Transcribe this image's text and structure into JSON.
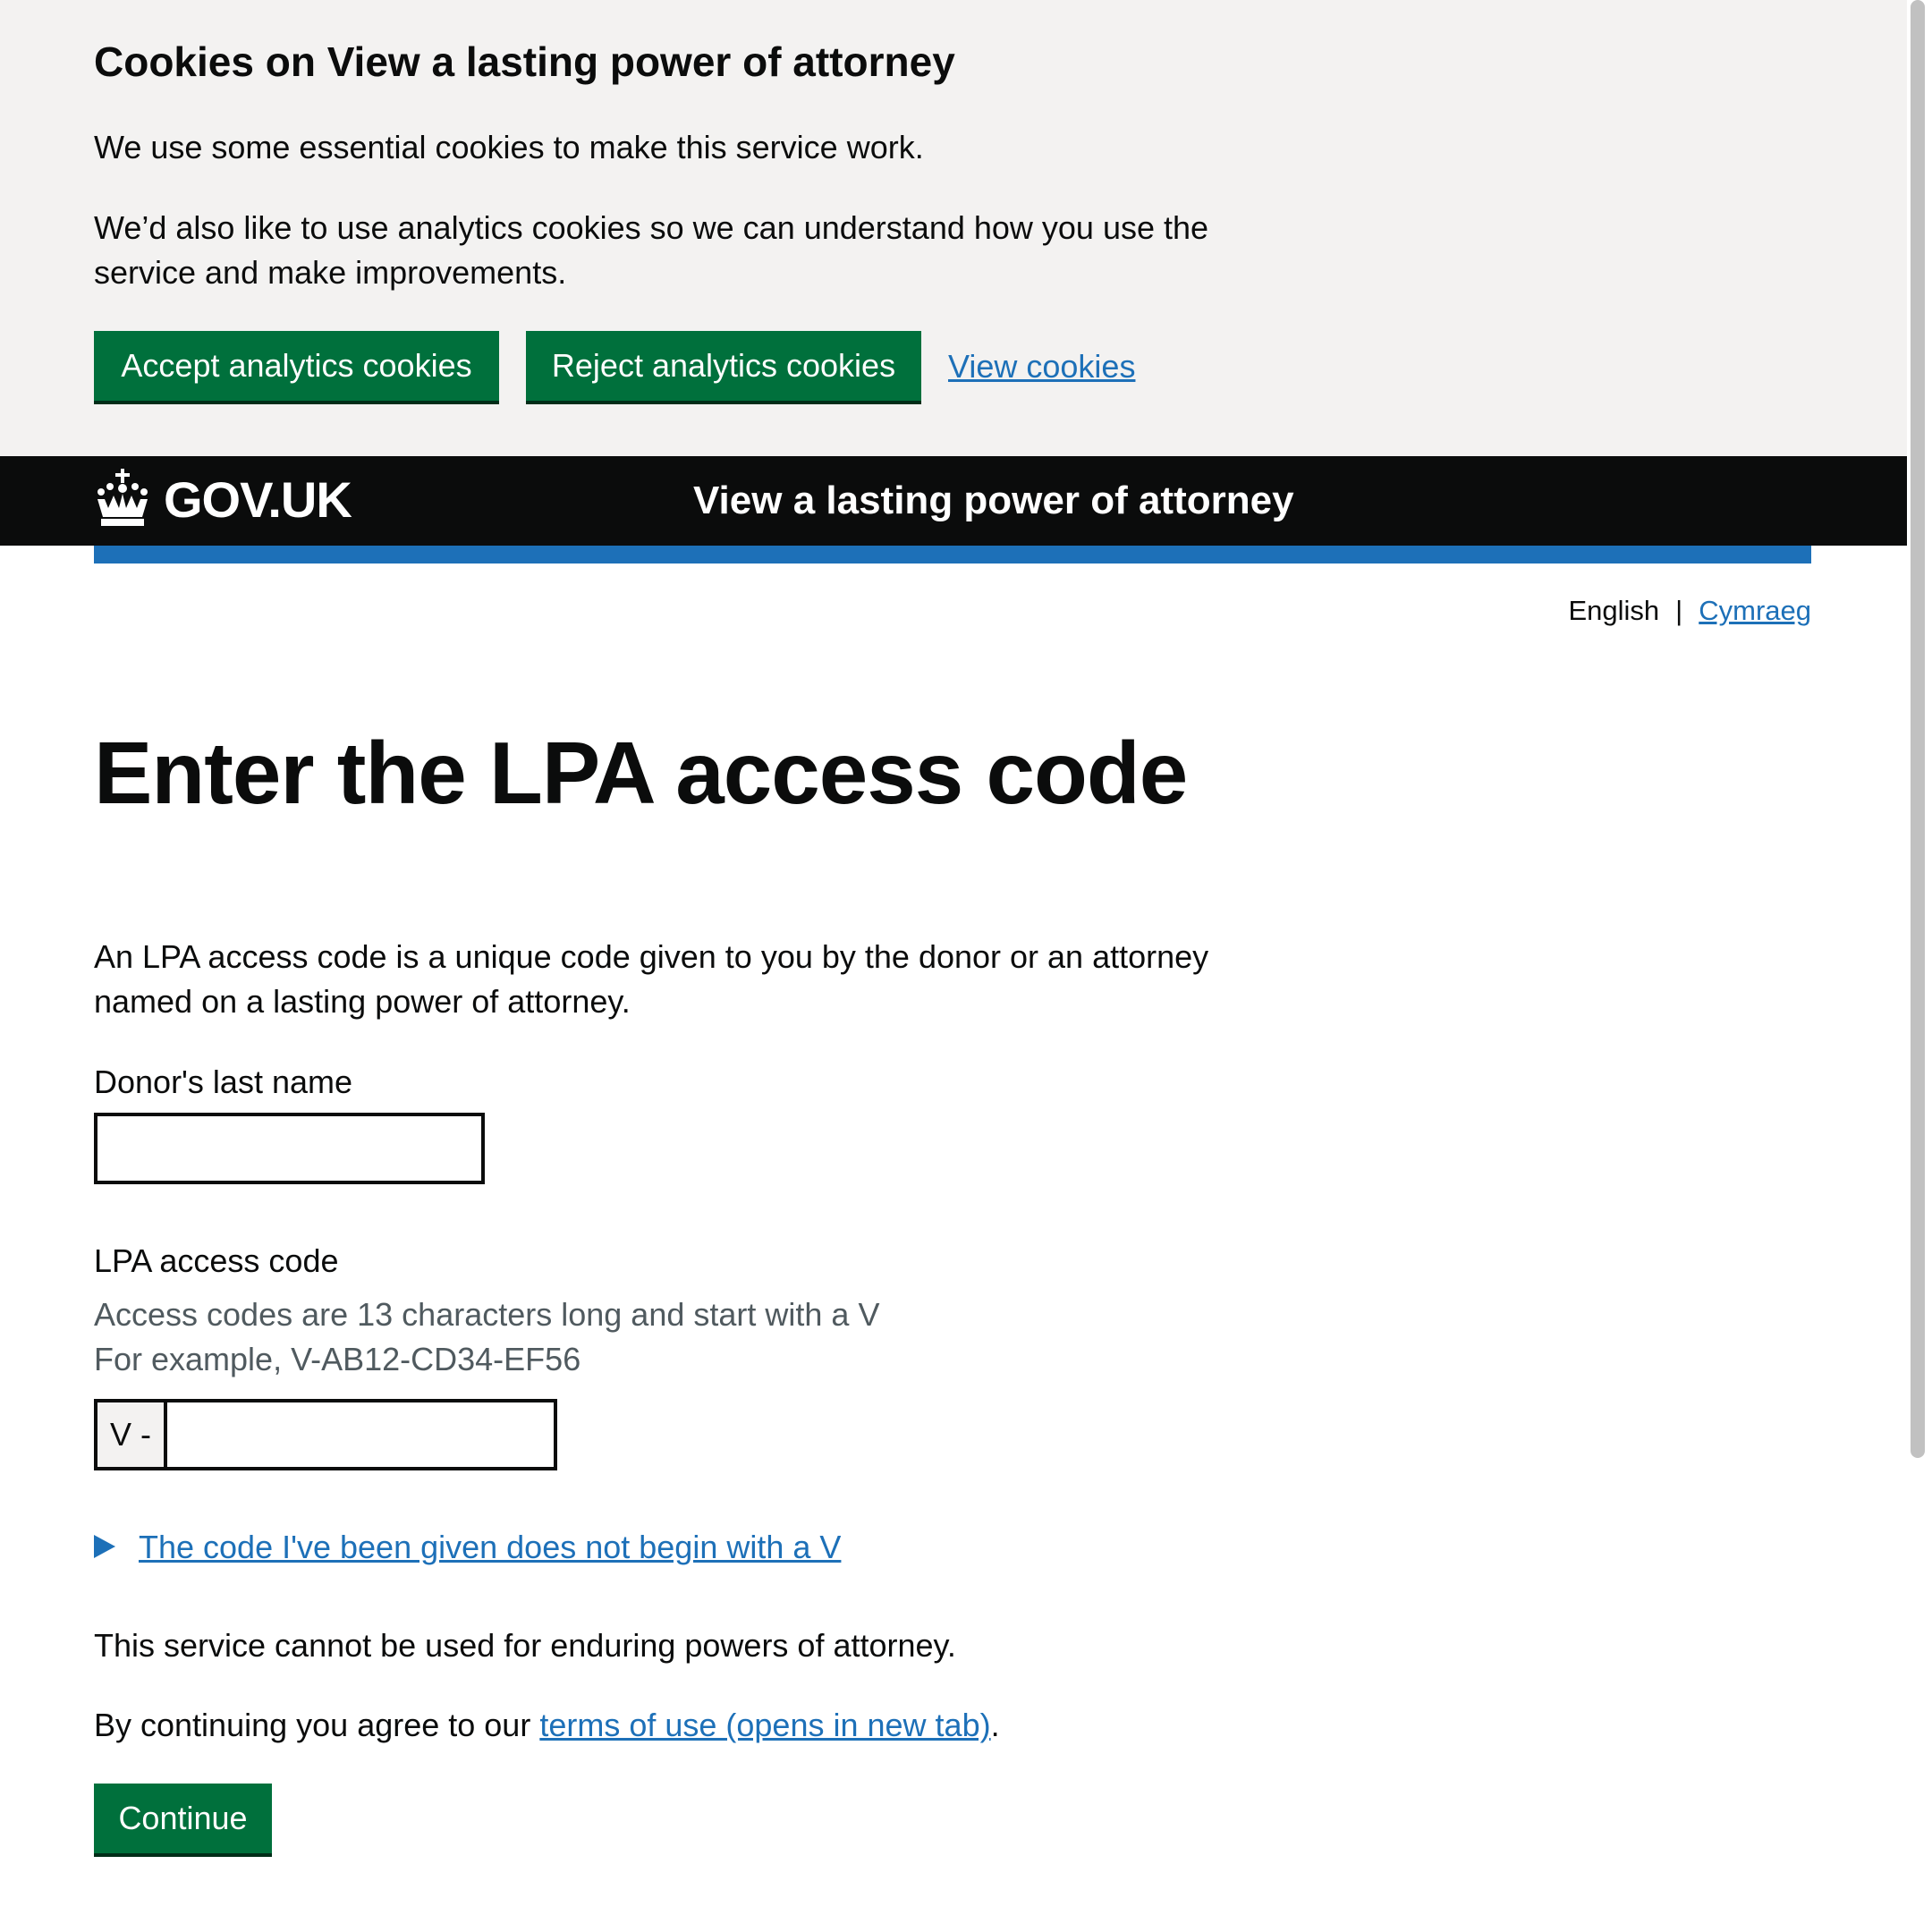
{
  "cookie_banner": {
    "title": "Cookies on View a lasting power of attorney",
    "p1": "We use some essential cookies to make this service work.",
    "p2": "We’d also like to use analytics cookies so we can understand how you use the service and make improvements.",
    "accept_label": "Accept analytics cookies",
    "reject_label": "Reject analytics cookies",
    "view_label": "View cookies"
  },
  "header": {
    "logo_text": "GOV.UK",
    "service_name": "View a lasting power of attorney",
    "crown_icon": "crown-icon"
  },
  "language": {
    "current": "English",
    "separator": "|",
    "other": "Cymraeg"
  },
  "main": {
    "title": "Enter the LPA access code",
    "intro": "An LPA access code is a unique code given to you by the donor or an attorney named on a lasting power of attorney.",
    "donor_label": "Donor's last name",
    "donor_value": "",
    "code_label": "LPA access code",
    "code_hint_1": "Access codes are 13 characters long and start with a V",
    "code_hint_2": "For example, V-AB12-CD34-EF56",
    "code_prefix": "V -",
    "code_value": "",
    "details_summary": "The code I've been given does not begin with a V",
    "epa_text": "This service cannot be used for enduring powers of attorney.",
    "terms_prefix": "By continuing you agree to our ",
    "terms_link": "terms of use (opens in new tab)",
    "terms_suffix": ".",
    "continue_label": "Continue"
  },
  "colors": {
    "button_green": "#00703c",
    "link_blue": "#1d70b8",
    "header_black": "#0b0c0c",
    "banner_grey": "#f3f2f1",
    "hint_grey": "#505a5f"
  }
}
